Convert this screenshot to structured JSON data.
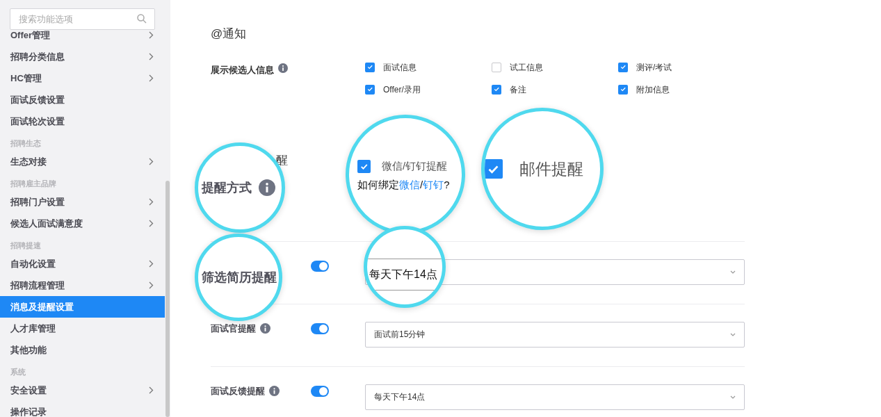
{
  "sidebar": {
    "search": {
      "placeholder": "搜索功能选项"
    },
    "items": [
      {
        "kind": "item",
        "label": "Offer管理",
        "arrow": true,
        "selected": false
      },
      {
        "kind": "item",
        "label": "招聘分类信息",
        "arrow": true,
        "selected": false
      },
      {
        "kind": "item",
        "label": "HC管理",
        "arrow": true,
        "selected": false
      },
      {
        "kind": "item",
        "label": "面试反馈设置",
        "arrow": false,
        "selected": false
      },
      {
        "kind": "item",
        "label": "面试轮次设置",
        "arrow": false,
        "selected": false
      },
      {
        "kind": "group",
        "label": "招聘生态"
      },
      {
        "kind": "item",
        "label": "生态对接",
        "arrow": true,
        "selected": false
      },
      {
        "kind": "group",
        "label": "招聘雇主品牌"
      },
      {
        "kind": "item",
        "label": "招聘门户设置",
        "arrow": true,
        "selected": false
      },
      {
        "kind": "item",
        "label": "候选人面试满意度",
        "arrow": true,
        "selected": false
      },
      {
        "kind": "group",
        "label": "招聘提速"
      },
      {
        "kind": "item",
        "label": "自动化设置",
        "arrow": true,
        "selected": false
      },
      {
        "kind": "item",
        "label": "招聘流程管理",
        "arrow": true,
        "selected": false
      },
      {
        "kind": "item",
        "label": "消息及提醒设置",
        "arrow": false,
        "selected": true
      },
      {
        "kind": "item",
        "label": "人才库管理",
        "arrow": false,
        "selected": false
      },
      {
        "kind": "item",
        "label": "其他功能",
        "arrow": false,
        "selected": false
      },
      {
        "kind": "group",
        "label": "系统"
      },
      {
        "kind": "item",
        "label": "安全设置",
        "arrow": true,
        "selected": false
      },
      {
        "kind": "item",
        "label": "操作记录",
        "arrow": false,
        "selected": false
      }
    ]
  },
  "main": {
    "title": "@通知",
    "display_info": {
      "label": "展示候选人信息",
      "info": true,
      "options": [
        {
          "label": "面试信息",
          "checked": true
        },
        {
          "label": "试工信息",
          "checked": false
        },
        {
          "label": "测评/考试",
          "checked": true
        },
        {
          "label": "Offer/录用",
          "checked": true
        },
        {
          "label": "备注",
          "checked": true
        },
        {
          "label": "附加信息",
          "checked": true
        }
      ]
    },
    "label_fragment": "醒",
    "rows": [
      {
        "on": true
      },
      {
        "label": "面试官提醒",
        "info": true,
        "on": true,
        "value": "面试前15分钟"
      },
      {
        "label": "面试反馈提醒",
        "info": true,
        "on": true,
        "value": "每天下午14点"
      }
    ]
  },
  "magnifiers": [
    {
      "kind": "label",
      "text": "提醒方式",
      "info": true
    },
    {
      "kind": "checkbox",
      "label": "微信/钉钉提醒",
      "checked": true,
      "help": [
        {
          "text": "如何绑定",
          "link": false
        },
        {
          "text": "微信",
          "link": true
        },
        {
          "text": "/",
          "link": false
        },
        {
          "text": "钉钉",
          "link": true
        },
        {
          "text": "?",
          "link": false
        }
      ]
    },
    {
      "kind": "checkbox",
      "label": "邮件提醒",
      "checked": true
    },
    {
      "kind": "label",
      "text": "筛选简历提醒",
      "info": false
    },
    {
      "kind": "value",
      "text": "每天下午14点"
    }
  ]
}
